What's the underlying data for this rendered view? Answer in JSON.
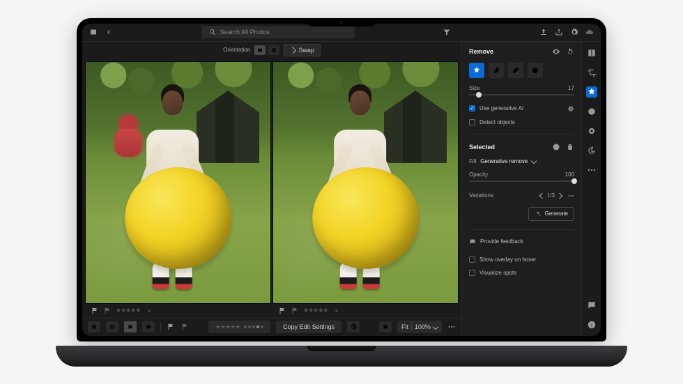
{
  "header": {
    "search_icon": "search",
    "search_placeholder": "Search All Photos",
    "filter_icon": "filter",
    "upload_icon": "upload",
    "share_icon": "share",
    "cloud_icon": "cloud"
  },
  "canvas_toolbar": {
    "orientation_label": "Orientation",
    "swap_label": "Swap"
  },
  "photo_meta": {
    "flag_icon": "flag",
    "reject_icon": "reject-flag",
    "stars": "★★★★★",
    "close": "×"
  },
  "bottom_bar": {
    "copy_edit_label": "Copy Edit Settings",
    "fit_label": "Fit",
    "zoom_value": "100%"
  },
  "panel": {
    "title": "Remove",
    "size_label": "Size",
    "size_value": "17",
    "use_gen_ai_label": "Use generative AI",
    "detect_objects_label": "Detect objects",
    "selected_label": "Selected",
    "fill_label": "Fill",
    "fill_value": "Generative remove",
    "opacity_label": "Opacity",
    "opacity_value": "100",
    "variations_label": "Variations",
    "variations_value": "1/3",
    "generate_label": "Generate",
    "feedback_label": "Provide feedback",
    "overlay_hover_label": "Show overlay on hover",
    "visualize_spots_label": "Visualize spots"
  },
  "rail_icons": {
    "crop": "crop",
    "presets": "presets",
    "heal": "heal",
    "mask": "mask",
    "history": "history",
    "more": "more",
    "comment": "comment",
    "info": "info"
  }
}
